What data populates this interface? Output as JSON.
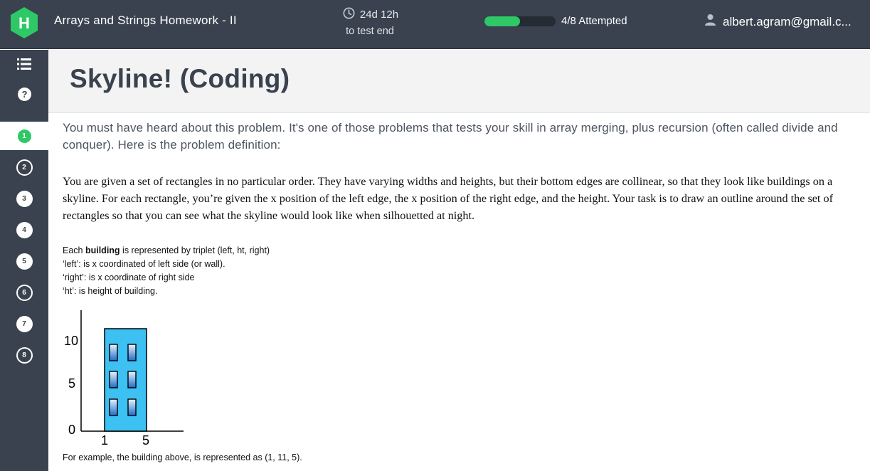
{
  "header": {
    "logo_letter": "H",
    "test_title": "Arrays and Strings Homework - II",
    "timer_value": "24d 12h",
    "timer_sub": "to test end",
    "progress_fraction": 0.5,
    "progress_text": "4/8 Attempted",
    "user_email": "albert.agram@gmail.c..."
  },
  "sidebar": {
    "tools": [
      "list-icon",
      "help-icon"
    ],
    "questions": [
      {
        "label": "1",
        "state": "current"
      },
      {
        "label": "2",
        "state": "open"
      },
      {
        "label": "3",
        "state": "answered"
      },
      {
        "label": "4",
        "state": "answered"
      },
      {
        "label": "5",
        "state": "answered"
      },
      {
        "label": "6",
        "state": "open"
      },
      {
        "label": "7",
        "state": "answered"
      },
      {
        "label": "8",
        "state": "open"
      }
    ]
  },
  "question": {
    "title": "Skyline! (Coding)",
    "intro": "You must have heard about this problem. It's one of those problems that tests your skill in array merging, plus recursion (often called divide and conquer). Here is the problem definition:",
    "definition": "You are given a set of    rectangles in no particular order. They have varying widths and heights, but their bottom edges are collinear, so that they look like buildings on a skyline. For each rectangle, you’re given the x position of the left edge, the x position of the right edge, and the height. Your task is to draw an outline around the set of rectangles so that you can see what the skyline would look like when silhouetted at night.",
    "list_line1_prefix": "Each ",
    "list_line1_bold": "building",
    "list_line1_suffix": " is represented by triplet (left, ht, right)",
    "list_line2": "‘left’: is x coordinated of left side (or wall).",
    "list_line3": "‘right’: is x coordinate of right side",
    "list_line4": "‘ht’: is height of building.",
    "figure": {
      "y_ticks": [
        "10",
        "5",
        "0"
      ],
      "x_ticks": [
        "1",
        "5"
      ],
      "building_color": "#3cc1f2"
    },
    "caption": "For example, the building above, is represented as (1, 11, 5)."
  },
  "colors": {
    "topbar": "#39424e",
    "accent": "#2ec866",
    "header_bg": "#f3f3f3"
  }
}
